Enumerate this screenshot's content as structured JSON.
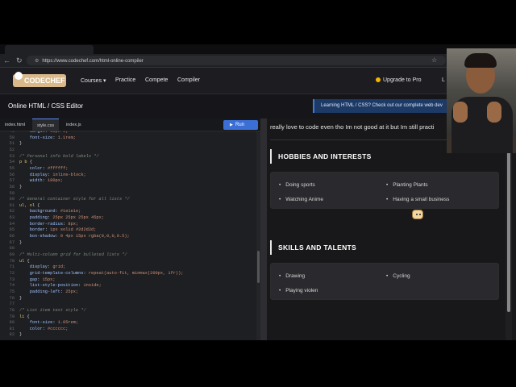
{
  "browser": {
    "url": "https://www.codechef.com/html-online-compiler",
    "tabs": [
      "",
      ""
    ]
  },
  "site": {
    "logo": "CODECHEF",
    "nav": [
      "Courses",
      "Practice",
      "Compete",
      "Compiler"
    ],
    "courses_caret": "▾",
    "upgrade": "Upgrade to Pro",
    "login_partial": "L"
  },
  "titlebar": {
    "title": "Online HTML / CSS Editor",
    "banner": "Learning HTML / CSS? Check out our complete web dev"
  },
  "editor": {
    "tabs": [
      "index.html",
      "style.css",
      "index.js"
    ],
    "active_tab": "style.css",
    "run_label": "Run",
    "lines": [
      {
        "n": "48",
        "t": "    margin: 15px 0;"
      },
      {
        "n": "50",
        "t": "    font-size: 1.1rem;"
      },
      {
        "n": "51",
        "t": "}"
      },
      {
        "n": "52",
        "t": ""
      },
      {
        "n": "53",
        "t": "/* Personal info bold labels */"
      },
      {
        "n": "54",
        "t": "p b {"
      },
      {
        "n": "55",
        "t": "    color: #ffffff;"
      },
      {
        "n": "56",
        "t": "    display: inline-block;"
      },
      {
        "n": "57",
        "t": "    width: 180px;"
      },
      {
        "n": "58",
        "t": "}"
      },
      {
        "n": "59",
        "t": ""
      },
      {
        "n": "60",
        "t": "/* General container style for all lists */"
      },
      {
        "n": "61",
        "t": "ul, ol {"
      },
      {
        "n": "62",
        "t": "    background: #1e1e1e;"
      },
      {
        "n": "63",
        "t": "    padding: 25px 25px 25px 45px;"
      },
      {
        "n": "64",
        "t": "    border-radius: 8px;"
      },
      {
        "n": "65",
        "t": "    border: 1px solid #2d2d2d;"
      },
      {
        "n": "66",
        "t": "    box-shadow: 0 4px 15px rgba(0,0,0,0.5);"
      },
      {
        "n": "67",
        "t": "}"
      },
      {
        "n": "68",
        "t": ""
      },
      {
        "n": "69",
        "t": "/* Multi-column grid for bulleted lists */"
      },
      {
        "n": "70",
        "t": "ul {"
      },
      {
        "n": "71",
        "t": "    display: grid;"
      },
      {
        "n": "72",
        "t": "    grid-template-columns: repeat(auto-fit, minmax(200px, 1fr));"
      },
      {
        "n": "73",
        "t": "    gap: 15px;"
      },
      {
        "n": "74",
        "t": "    list-style-position: inside;"
      },
      {
        "n": "75",
        "t": "    padding-left: 25px;"
      },
      {
        "n": "76",
        "t": "}"
      },
      {
        "n": "77",
        "t": ""
      },
      {
        "n": "78",
        "t": "/* List item text style */"
      },
      {
        "n": "79",
        "t": "li {"
      },
      {
        "n": "80",
        "t": "    font-size: 1.05rem;"
      },
      {
        "n": "81",
        "t": "    color: #cccccc;"
      },
      {
        "n": "82",
        "t": "}"
      }
    ]
  },
  "preview": {
    "intro": "really love to code even tho Im not good at it but Im still practi",
    "hobbies": {
      "heading": "HOBBIES AND INTERESTS",
      "items": [
        "Doing sports",
        "Planting Plants",
        "Watching Anime",
        "Having a small business"
      ]
    },
    "skills": {
      "heading": "SKILLS AND TALENTS",
      "items": [
        "Drawing",
        "Cycling",
        "Playing violen"
      ]
    }
  },
  "colors": {
    "accent_blue": "#3c6fd6",
    "banner_bg": "#1d3a66",
    "upgrade_coin": "#f5b400"
  }
}
